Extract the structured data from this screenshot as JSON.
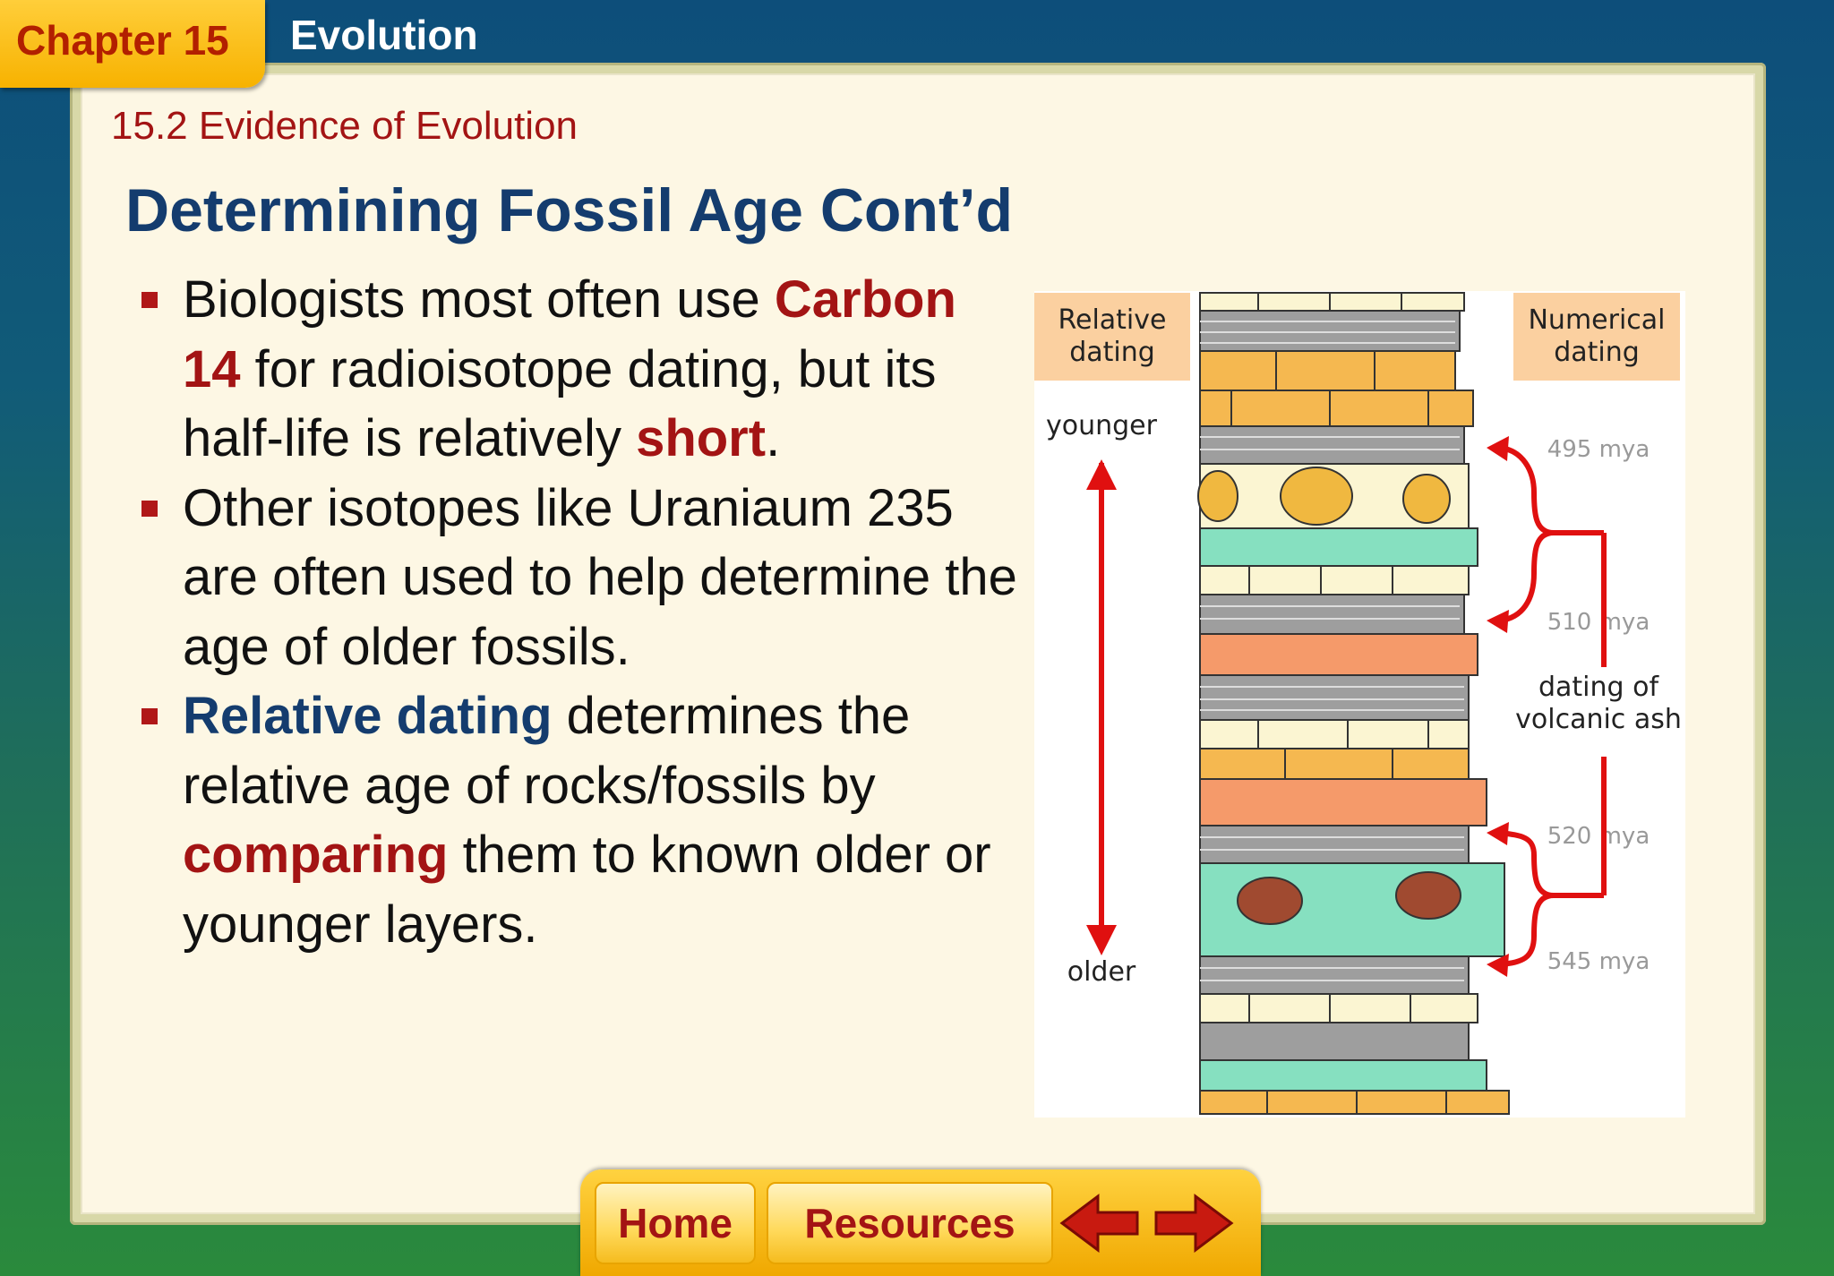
{
  "header": {
    "chapter": "Chapter 15",
    "topic": "Evolution"
  },
  "section": "15.2 Evidence of Evolution",
  "title": "Determining Fossil Age Cont’d",
  "bullets": [
    {
      "t1": "Biologists most often use ",
      "k1": "Carbon 14",
      "t2": " for radioisotope dating, but its half-life is relatively ",
      "k2": "short",
      "t3": "."
    },
    {
      "t1": "Other isotopes like Uraniaum 235 are often used to help determine the age of older fossils."
    },
    {
      "k1": "Relative dating",
      "t1": " determines the relative age of rocks/fossils by ",
      "k2": "comparing",
      "t2": " them to known older or younger layers."
    }
  ],
  "figure": {
    "relative_label_1": "Relative",
    "relative_label_2": "dating",
    "numerical_label_1": "Numerical",
    "numerical_label_2": "dating",
    "younger": "younger",
    "older": "older",
    "ages": [
      "495 mya",
      "510 mya",
      "520 mya",
      "545 mya"
    ],
    "ash_label_1": "dating of",
    "ash_label_2": "volcanic ash"
  },
  "nav": {
    "home": "Home",
    "resources": "Resources",
    "prev_icon": "left-arrow-icon",
    "next_icon": "right-arrow-icon"
  },
  "colors": {
    "accent_red": "#a31414",
    "title_blue": "#143c6e",
    "tab_gold": "#f7b200"
  }
}
